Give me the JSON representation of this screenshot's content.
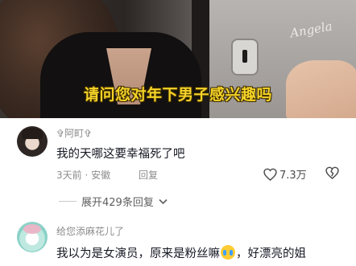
{
  "video": {
    "subtitle": "请问您对年下男子感兴趣吗",
    "watermark": "Angela"
  },
  "comments": [
    {
      "username": "✞阿町✞",
      "text": "我的天哪这要幸福死了吧",
      "time": "3天前",
      "location": "安徽",
      "reply_label": "回复",
      "likes": "7.3万",
      "expand_label": "展开429条回复"
    },
    {
      "username": "给您添麻花儿了",
      "text_before": "我以为是女演员，原来是粉丝嘛",
      "emoji": "crying-face",
      "text_after": "，好漂亮的姐"
    }
  ],
  "colors": {
    "subtitle": "#f5d328",
    "text_primary": "#161823",
    "text_secondary": "#8c8c8c"
  }
}
